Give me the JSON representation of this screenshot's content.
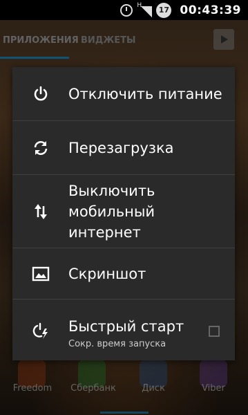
{
  "status_bar": {
    "time": "00:43:39",
    "battery_level": "17",
    "signal_badge": "H"
  },
  "drawer": {
    "tabs": [
      "ПРИЛОЖЕНИЯ",
      "ВИДЖЕТЫ"
    ]
  },
  "dock": {
    "apps": [
      "Freedom",
      "Сбербанк",
      "Диск",
      "Viber"
    ]
  },
  "power_menu": {
    "items": [
      {
        "label": "Отключить питание",
        "icon": "power-icon"
      },
      {
        "label": "Перезагрузка",
        "icon": "reboot-icon"
      },
      {
        "label": "Выключить мобильный интернет",
        "line1": "Выключить",
        "line2": "мобильный",
        "line3": "интернет",
        "icon": "mobile-data-icon"
      },
      {
        "label": "Скриншот",
        "icon": "screenshot-icon"
      },
      {
        "label": "Быстрый старт",
        "subtitle": "Сокр. время запуска",
        "icon": "fast-boot-icon",
        "checked": false
      }
    ]
  }
}
